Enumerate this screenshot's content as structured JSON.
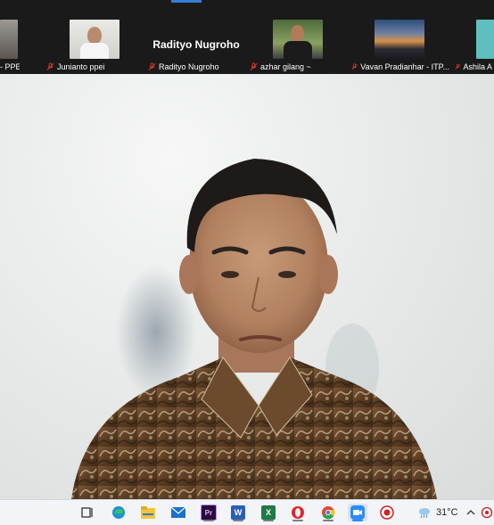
{
  "participants": [
    {
      "name": "- PPEI",
      "muted": false
    },
    {
      "name": "Junianto ppei",
      "muted": true
    },
    {
      "name": "Radityo Nugroho",
      "muted": true,
      "display_name": "Radityo Nugroho"
    },
    {
      "name": "azhar gilang ~",
      "muted": true
    },
    {
      "name": "Vavan Pradianhar - ITP...",
      "muted": true
    },
    {
      "name": "Ashila A",
      "muted": true
    }
  ],
  "taskbar": {
    "icons": [
      "task-view",
      "edge",
      "file-explorer",
      "mail",
      "premiere-pro",
      "word",
      "excel",
      "opera",
      "chrome",
      "zoom",
      "screen-recorder"
    ],
    "temperature": "31°C"
  },
  "colors": {
    "taskbar_bg": "#f2f4f7",
    "strip_bg": "#1a1a1a",
    "mic_off": "#e0352b"
  }
}
